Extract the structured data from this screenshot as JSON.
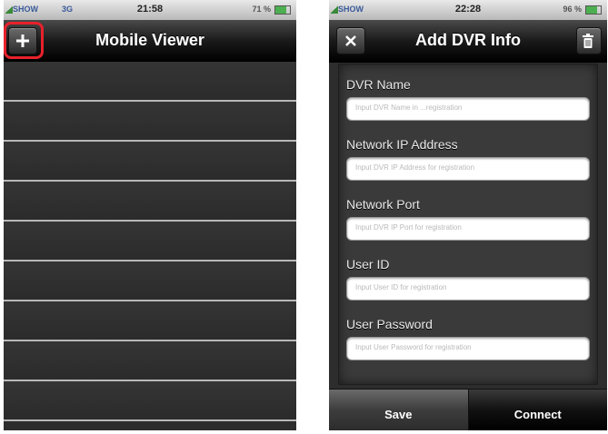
{
  "left_screen": {
    "status": {
      "carrier": "SHOW",
      "network": "3G",
      "time": "21:58",
      "battery": "71 %"
    },
    "title": "Mobile Viewer",
    "add_icon": "plus-icon",
    "highlight_color": "#e8212b",
    "row_count": 9
  },
  "right_screen": {
    "status": {
      "carrier": "SHOW",
      "time": "22:28",
      "battery": "96 %"
    },
    "title": "Add DVR Info",
    "close_icon": "close-icon",
    "trash_icon": "trash-icon",
    "fields": [
      {
        "label": "DVR Name",
        "placeholder": "Input DVR Name in ...registration"
      },
      {
        "label": "Network IP Address",
        "placeholder": "Input DVR IP Address for registration"
      },
      {
        "label": "Network Port",
        "placeholder": "Input DVR IP Port for registration"
      },
      {
        "label": "User ID",
        "placeholder": "Input User ID for registration"
      },
      {
        "label": "User Password",
        "placeholder": "Input User Password for registration"
      }
    ],
    "toolbar": {
      "save_label": "Save",
      "connect_label": "Connect"
    }
  }
}
